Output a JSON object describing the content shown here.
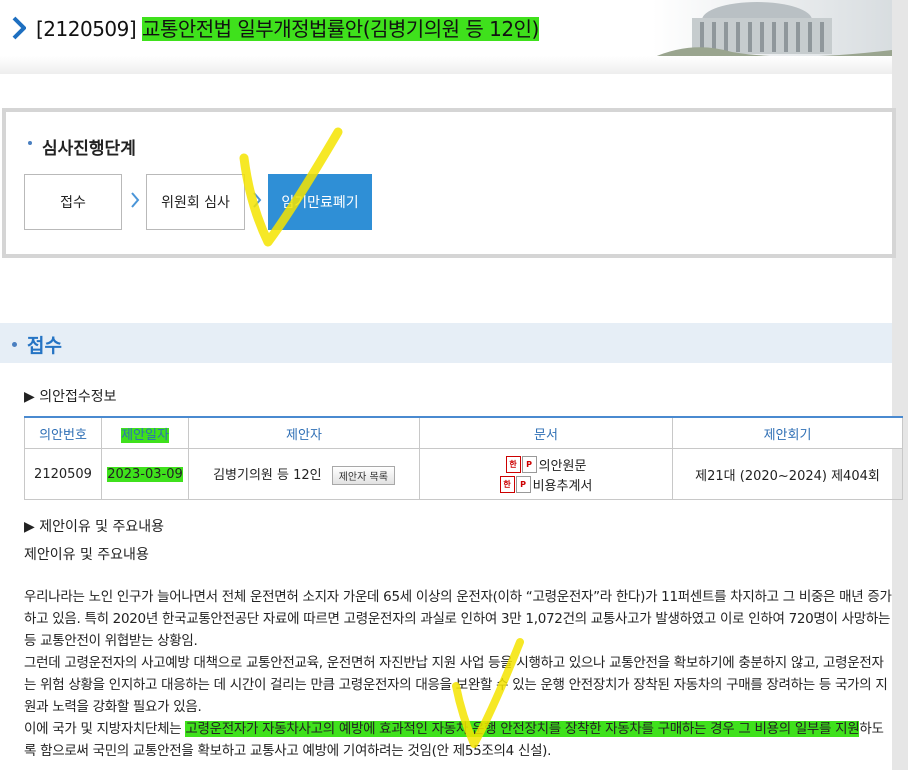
{
  "header": {
    "bill_no": "[2120509]",
    "bill_name": "교통안전법 일부개정법률안(김병기의원 등 12인)"
  },
  "stage": {
    "title": "심사진행단계",
    "steps": [
      "접수",
      "위원회 심사",
      "임기만료폐기"
    ],
    "active_step": "임기만료폐기",
    "active_color": "#2f8fd6"
  },
  "section": {
    "title": "접수",
    "accent_color": "#2574c4"
  },
  "receipt": {
    "heading": "▶ 의안접수정보",
    "columns": [
      "의안번호",
      "제안일자",
      "제안자",
      "문서",
      "제안회기"
    ],
    "row": {
      "bill_no": "2120509",
      "date": "2023-03-09",
      "proposer": "김병기의원 등 12인",
      "proposer_button": "제안자 목록",
      "docs": [
        "의안원문",
        "비용추계서"
      ],
      "session": "제21대 (2020~2024) 제404회"
    }
  },
  "reason": {
    "heading": "▶ 제안이유 및 주요내용",
    "label": "제안이유 및 주요내용",
    "p1": "우리나라는 노인 인구가 늘어나면서 전체 운전면허 소지자 가운데 65세 이상의 운전자(이하 “고령운전자”라 한다)가 11퍼센트를 차지하고 그 비중은 매년 증가하고 있음. 특히 2020년 한국교통안전공단 자료에 따르면 고령운전자의 과실로 인하여 3만 1,072건의 교통사고가 발생하였고 이로 인하여 720명이 사망하는 등 교통안전이 위협받는 상황임.",
    "p2": "그런데 고령운전자의 사고예방 대책으로 교통안전교육, 운전면허 자진반납 지원 사업 등을 시행하고 있으나 교통안전을 확보하기에 충분하지 않고, 고령운전자는 위험 상황을 인지하고 대응하는 데 시간이 걸리는 만큼 고령운전자의 대응을 보완할 수 있는 운행 안전장치가 장착된 자동차의 구매를 장려하는 등 국가의 지원과 노력을 강화할 필요가 있음.",
    "p3_before": "이에 국가 및 지방자치단체는 ",
    "p3_highlight": "고령운전자가 자동차사고의 예방에 효과적인 자동차 운행 안전장치를 장착한 자동차를 구매하는 경우 그 비용의 일부를 지원",
    "p3_after": "하도록 함으로써 국민의 교통안전을 확보하고 교통사고 예방에 기여하려는 것임(안 제55조의4 신설)."
  },
  "colors": {
    "highlight": "#3fe11c",
    "check_mark": "#f5e400",
    "section_band": "#e6eef6"
  }
}
